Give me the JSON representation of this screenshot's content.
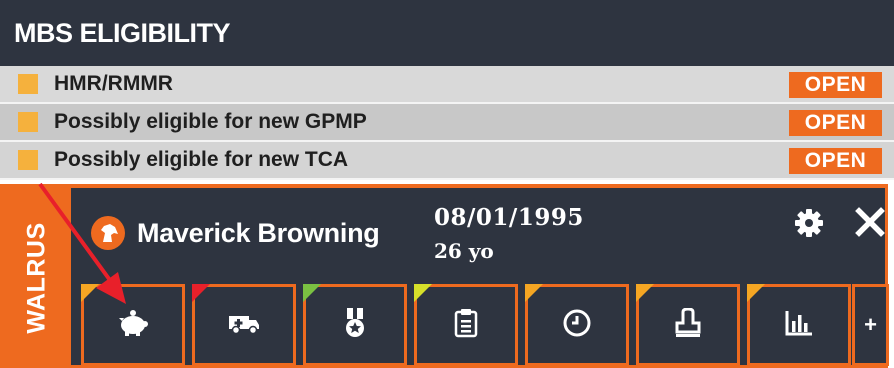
{
  "mbs": {
    "title": "MBS ELIGIBILITY",
    "rows": [
      {
        "label": "HMR/RMMR",
        "status": "OPEN"
      },
      {
        "label": "Possibly eligible for new GPMP",
        "status": "OPEN"
      },
      {
        "label": "Possibly eligible for new TCA",
        "status": "OPEN"
      }
    ],
    "row_marker_color": "#f5b13d",
    "status_color": "#ee6a1f"
  },
  "patient": {
    "tab_label": "WALRUS",
    "name": "Maverick Browning",
    "dob": "08/01/1995",
    "age": "26 yo",
    "avatar_icon": "horse-head-icon"
  },
  "actions": {
    "settings_icon": "gear-icon",
    "close_icon": "close-icon",
    "more_label": "+"
  },
  "tiles": [
    {
      "icon": "piggy-bank-icon",
      "flag_color": "#f5a623"
    },
    {
      "icon": "ambulance-icon",
      "flag_color": "#e8202a"
    },
    {
      "icon": "medal-icon",
      "flag_color": "#7ac142"
    },
    {
      "icon": "clipboard-icon",
      "flag_color": "#d6e02a"
    },
    {
      "icon": "clock-icon",
      "flag_color": "#f5a623"
    },
    {
      "icon": "stamp-icon",
      "flag_color": "#f5a623"
    },
    {
      "icon": "bar-chart-icon",
      "flag_color": "#f5a623"
    }
  ],
  "colors": {
    "dark": "#2e3440",
    "accent": "#ee6a1f",
    "annotation_arrow": "#e8202a"
  }
}
